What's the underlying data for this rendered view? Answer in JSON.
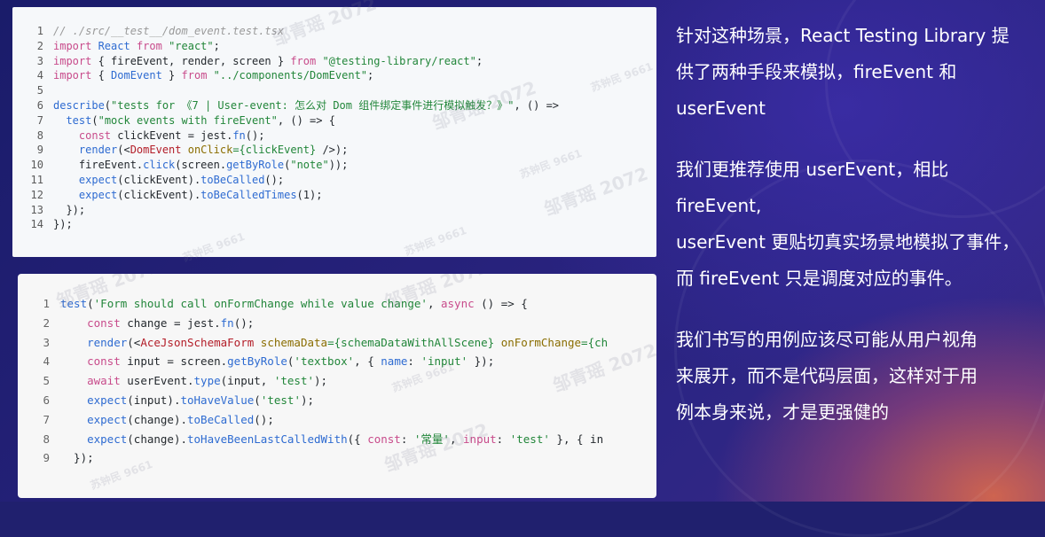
{
  "code_panel_1": {
    "lines": [
      {
        "n": "1",
        "tokens": [
          {
            "t": "// ./src/__test__/dom_event.test.tsx",
            "c": "cm"
          }
        ]
      },
      {
        "n": "2",
        "tokens": [
          {
            "t": "import ",
            "c": "kw2"
          },
          {
            "t": "React ",
            "c": "bl"
          },
          {
            "t": "from ",
            "c": "kw2"
          },
          {
            "t": "\"react\"",
            "c": "str"
          },
          {
            "t": ";",
            "c": "pl"
          }
        ]
      },
      {
        "n": "3",
        "tokens": [
          {
            "t": "import ",
            "c": "kw2"
          },
          {
            "t": "{ fireEvent, render, screen } ",
            "c": "pl"
          },
          {
            "t": "from ",
            "c": "kw2"
          },
          {
            "t": "\"@testing-library/react\"",
            "c": "str"
          },
          {
            "t": ";",
            "c": "pl"
          }
        ]
      },
      {
        "n": "4",
        "tokens": [
          {
            "t": "import ",
            "c": "kw2"
          },
          {
            "t": "{ ",
            "c": "pl"
          },
          {
            "t": "DomEvent",
            "c": "bl"
          },
          {
            "t": " } ",
            "c": "pl"
          },
          {
            "t": "from ",
            "c": "kw2"
          },
          {
            "t": "\"../components/DomEvent\"",
            "c": "str"
          },
          {
            "t": ";",
            "c": "pl"
          }
        ]
      },
      {
        "n": "5",
        "tokens": []
      },
      {
        "n": "6",
        "tokens": [
          {
            "t": "describe",
            "c": "bl"
          },
          {
            "t": "(",
            "c": "pl"
          },
          {
            "t": "\"tests for 《7 | User-event: 怎么对 Dom 组件绑定事件进行模拟触发？》\"",
            "c": "str"
          },
          {
            "t": ", () =>",
            "c": "pl"
          }
        ]
      },
      {
        "n": "7",
        "tokens": [
          {
            "t": "  test",
            "c": "bl"
          },
          {
            "t": "(",
            "c": "pl"
          },
          {
            "t": "\"mock events with fireEvent\"",
            "c": "str"
          },
          {
            "t": ", () => {",
            "c": "pl"
          }
        ]
      },
      {
        "n": "8",
        "tokens": [
          {
            "t": "    const ",
            "c": "kw2"
          },
          {
            "t": "clickEvent = ",
            "c": "pl"
          },
          {
            "t": "jest",
            "c": "pl"
          },
          {
            "t": ".",
            "c": "pl"
          },
          {
            "t": "fn",
            "c": "bl"
          },
          {
            "t": "();",
            "c": "pl"
          }
        ]
      },
      {
        "n": "9",
        "tokens": [
          {
            "t": "    render",
            "c": "bl"
          },
          {
            "t": "(<",
            "c": "pl"
          },
          {
            "t": "DomEvent ",
            "c": "tag"
          },
          {
            "t": "onClick",
            "c": "attr"
          },
          {
            "t": "={clickEvent}",
            "c": "str"
          },
          {
            "t": " />);",
            "c": "pl"
          }
        ]
      },
      {
        "n": "10",
        "tokens": [
          {
            "t": "    fireEvent",
            "c": "pl"
          },
          {
            "t": ".",
            "c": "pl"
          },
          {
            "t": "click",
            "c": "bl"
          },
          {
            "t": "(screen.",
            "c": "pl"
          },
          {
            "t": "getByRole",
            "c": "bl"
          },
          {
            "t": "(",
            "c": "pl"
          },
          {
            "t": "\"note\"",
            "c": "str"
          },
          {
            "t": "));",
            "c": "pl"
          }
        ]
      },
      {
        "n": "11",
        "tokens": [
          {
            "t": "    expect",
            "c": "bl"
          },
          {
            "t": "(clickEvent).",
            "c": "pl"
          },
          {
            "t": "toBeCalled",
            "c": "bl"
          },
          {
            "t": "();",
            "c": "pl"
          }
        ]
      },
      {
        "n": "12",
        "tokens": [
          {
            "t": "    expect",
            "c": "bl"
          },
          {
            "t": "(clickEvent).",
            "c": "pl"
          },
          {
            "t": "toBeCalledTimes",
            "c": "bl"
          },
          {
            "t": "(1);",
            "c": "pl"
          }
        ]
      },
      {
        "n": "13",
        "tokens": [
          {
            "t": "  });",
            "c": "pl"
          }
        ]
      },
      {
        "n": "14",
        "tokens": [
          {
            "t": "});",
            "c": "pl"
          }
        ]
      }
    ]
  },
  "code_panel_2": {
    "lines": [
      {
        "n": "1",
        "tokens": [
          {
            "t": "test",
            "c": "bl"
          },
          {
            "t": "(",
            "c": "pl"
          },
          {
            "t": "'Form should call onFormChange while value change'",
            "c": "str"
          },
          {
            "t": ", ",
            "c": "pl"
          },
          {
            "t": "async ",
            "c": "kw2"
          },
          {
            "t": "() => {",
            "c": "pl"
          }
        ]
      },
      {
        "n": "2",
        "tokens": [
          {
            "t": "    const ",
            "c": "kw2"
          },
          {
            "t": "change = jest.",
            "c": "pl"
          },
          {
            "t": "fn",
            "c": "bl"
          },
          {
            "t": "();",
            "c": "pl"
          }
        ]
      },
      {
        "n": "3",
        "tokens": [
          {
            "t": "    render",
            "c": "bl"
          },
          {
            "t": "(<",
            "c": "pl"
          },
          {
            "t": "AceJsonSchemaForm ",
            "c": "tag"
          },
          {
            "t": "schemaData",
            "c": "attr"
          },
          {
            "t": "={schemaDataWithAllScene} ",
            "c": "str"
          },
          {
            "t": "onFormChange",
            "c": "attr"
          },
          {
            "t": "={ch",
            "c": "str"
          }
        ]
      },
      {
        "n": "4",
        "tokens": [
          {
            "t": "    const ",
            "c": "kw2"
          },
          {
            "t": "input = screen.",
            "c": "pl"
          },
          {
            "t": "getByRole",
            "c": "bl"
          },
          {
            "t": "(",
            "c": "pl"
          },
          {
            "t": "'textbox'",
            "c": "str"
          },
          {
            "t": ", { ",
            "c": "pl"
          },
          {
            "t": "name",
            "c": "bl"
          },
          {
            "t": ": ",
            "c": "pl"
          },
          {
            "t": "'input'",
            "c": "str"
          },
          {
            "t": " });",
            "c": "pl"
          }
        ]
      },
      {
        "n": "5",
        "tokens": [
          {
            "t": "    await ",
            "c": "kw2"
          },
          {
            "t": "userEvent.",
            "c": "pl"
          },
          {
            "t": "type",
            "c": "bl"
          },
          {
            "t": "(input, ",
            "c": "pl"
          },
          {
            "t": "'test'",
            "c": "str"
          },
          {
            "t": ");",
            "c": "pl"
          }
        ]
      },
      {
        "n": "6",
        "tokens": [
          {
            "t": "    expect",
            "c": "bl"
          },
          {
            "t": "(input).",
            "c": "pl"
          },
          {
            "t": "toHaveValue",
            "c": "bl"
          },
          {
            "t": "(",
            "c": "pl"
          },
          {
            "t": "'test'",
            "c": "str"
          },
          {
            "t": ");",
            "c": "pl"
          }
        ]
      },
      {
        "n": "7",
        "tokens": [
          {
            "t": "    expect",
            "c": "bl"
          },
          {
            "t": "(change).",
            "c": "pl"
          },
          {
            "t": "toBeCalled",
            "c": "bl"
          },
          {
            "t": "();",
            "c": "pl"
          }
        ]
      },
      {
        "n": "8",
        "tokens": [
          {
            "t": "    expect",
            "c": "bl"
          },
          {
            "t": "(change).",
            "c": "pl"
          },
          {
            "t": "toHaveBeenLastCalledWith",
            "c": "bl"
          },
          {
            "t": "({ ",
            "c": "pl"
          },
          {
            "t": "const",
            "c": "kw2"
          },
          {
            "t": ": ",
            "c": "pl"
          },
          {
            "t": "'常量'",
            "c": "str"
          },
          {
            "t": ", ",
            "c": "pl"
          },
          {
            "t": "input",
            "c": "kw2"
          },
          {
            "t": ": ",
            "c": "pl"
          },
          {
            "t": "'test'",
            "c": "str"
          },
          {
            "t": " }, { in",
            "c": "pl"
          }
        ]
      },
      {
        "n": "9",
        "tokens": [
          {
            "t": "  });",
            "c": "pl"
          }
        ]
      }
    ]
  },
  "watermarks": [
    "邹青瑶 2072",
    "邹青瑶 2072",
    "邹青瑶 2072",
    "邹青瑶 2072",
    "邹青瑶 2072",
    "邹青瑶 2072",
    "邹青瑶 2072",
    "苏钟民 9661",
    "苏钟民 9661",
    "苏钟民 9661",
    "苏钟民 9661",
    "苏钟民 9661",
    "苏钟民 9661"
  ],
  "explanation": {
    "paragraphs": [
      [
        "针对这种场景，React Testing Library 提",
        "供了两种手段来模拟，fireEvent 和",
        "userEvent"
      ],
      [
        "我们更推荐使用 userEvent，相比",
        "fireEvent,",
        "userEvent 更贴切真实场景地模拟了事件，",
        "而 fireEvent 只是调度对应的事件。"
      ],
      [
        "我们书写的用例应该尽可能从用户视角",
        "来展开，而不是代码层面，这样对于用",
        "例本身来说，才是更强健的"
      ]
    ]
  }
}
